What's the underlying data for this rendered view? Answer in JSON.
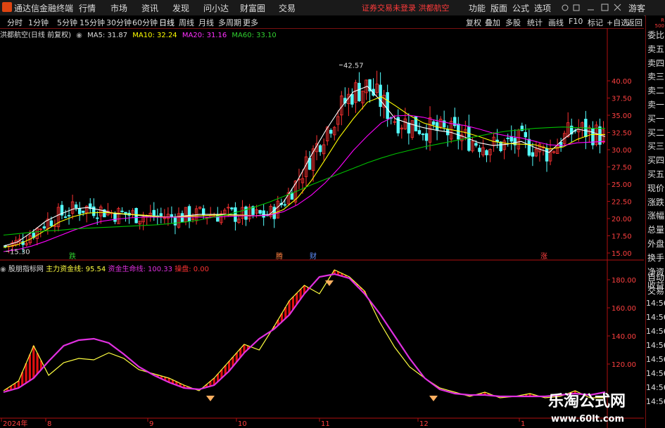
{
  "topbar": {
    "app_title": "通达信金融终端",
    "menus": [
      "行情",
      "市场",
      "资讯",
      "发现",
      "问小达",
      "财富圈",
      "交易"
    ],
    "notice": "证券交易未登录  洪都航空",
    "right_menus": [
      "功能",
      "版面",
      "公式",
      "选项"
    ],
    "guest": "游客"
  },
  "periodbar": {
    "periods": [
      "分时",
      "1分钟",
      "5分钟",
      "15分钟",
      "30分钟",
      "60分钟",
      "日线",
      "周线",
      "月线",
      "多周期",
      "更多"
    ],
    "active": "日线",
    "tools": [
      "复权",
      "叠加",
      "多股",
      "统计",
      "画线",
      "F10",
      "标记",
      "+自选",
      "返回"
    ]
  },
  "infoline": {
    "stock": "洪都航空(日线 前复权)",
    "ma5": "MA5: 31.87",
    "ma10": "MA10: 32.24",
    "ma20": "MA20: 31.16",
    "ma60": "MA60: 33.10"
  },
  "indicator": {
    "name": "股朋指标网",
    "main_fund": "主力资金线: 95.54",
    "life_line": "资金生命线: 100.33",
    "operate": "操盘: 0.00"
  },
  "rightpanel": {
    "r_label": "R\n500",
    "items": [
      "委比",
      "卖五",
      "卖四",
      "卖三",
      "卖二",
      "卖一",
      "买一",
      "买二",
      "买三",
      "买四",
      "买五",
      "现价",
      "涨跌",
      "涨幅",
      "总量",
      "外盘",
      "换手",
      "净资",
      "收益"
    ],
    "lower": [
      "自动",
      "交易"
    ],
    "times": [
      "14:56",
      "14:56",
      "14:56",
      "14:56",
      "14:56",
      "14:56",
      "14:56",
      "14:56"
    ]
  },
  "colors": {
    "up": "#ff3232",
    "down": "#54ffff",
    "ma5": "#ffffff",
    "ma10": "#ffff00",
    "ma20": "#ff00ff",
    "ma60": "#00c000",
    "life": "#e030e0",
    "fund": "#ffff40",
    "axis": "#b01010"
  },
  "chart_data": [
    {
      "type": "candlestick",
      "title": "洪都航空(日线 前复权)",
      "y_ticks": [
        "40.00",
        "37.50",
        "35.00",
        "32.50",
        "30.00",
        "27.50",
        "25.00",
        "22.50",
        "20.00",
        "17.50",
        "15.00"
      ],
      "ylim": [
        14.5,
        43.5
      ],
      "annotations": {
        "high": "42.57",
        "low": "15.30"
      },
      "markers": [
        "跌",
        "腾",
        "财",
        "涨"
      ],
      "x_ticks": [
        "2024年",
        "8",
        "9",
        "10",
        "11",
        "12",
        "1"
      ],
      "series": [
        {
          "name": "MA5",
          "values": [
            16.0,
            16.6,
            18.0,
            19.6,
            20.6,
            21.4,
            21.6,
            21.2,
            20.7,
            20.6,
            20.4,
            20.3,
            20.2,
            20.4,
            20.6,
            20.6,
            20.6,
            20.5,
            20.4,
            20.6,
            22.4,
            25.5,
            29.2,
            32.7,
            35.8,
            38.4,
            39.2,
            37.0,
            34.5,
            33.8,
            33.2,
            32.8,
            32.5,
            31.8,
            31.0,
            30.6,
            30.8,
            31.2,
            30.3,
            29.6,
            31.5,
            33.0,
            32.6,
            31.9
          ]
        },
        {
          "name": "MA10",
          "values": [
            15.8,
            16.2,
            17.1,
            18.3,
            19.5,
            20.3,
            20.8,
            20.9,
            20.8,
            20.6,
            20.5,
            20.3,
            20.2,
            20.3,
            20.4,
            20.5,
            20.5,
            20.5,
            20.4,
            20.5,
            21.3,
            23.0,
            25.5,
            28.6,
            31.8,
            34.5,
            36.9,
            37.7,
            36.4,
            35.0,
            33.9,
            33.3,
            32.9,
            32.5,
            31.9,
            31.2,
            30.9,
            30.8,
            30.7,
            30.1,
            30.4,
            31.5,
            32.2,
            32.2
          ]
        },
        {
          "name": "MA20",
          "values": [
            15.2,
            15.5,
            16.0,
            16.7,
            17.5,
            18.3,
            19.0,
            19.6,
            19.9,
            20.1,
            20.2,
            20.2,
            20.2,
            20.2,
            20.2,
            20.2,
            20.3,
            20.4,
            20.4,
            20.5,
            21.0,
            22.0,
            23.4,
            25.2,
            27.4,
            29.9,
            32.0,
            33.9,
            34.9,
            35.0,
            34.7,
            34.2,
            33.8,
            33.5,
            33.0,
            32.4,
            32.0,
            31.7,
            31.2,
            30.7,
            30.6,
            31.0,
            31.1,
            31.2
          ]
        },
        {
          "name": "MA60",
          "values": [
            17.6,
            17.8,
            18.0,
            18.2,
            18.3,
            18.5,
            18.6,
            18.7,
            18.8,
            18.9,
            19.0,
            19.1,
            19.3,
            19.5,
            19.8,
            20.2,
            20.6,
            21.1,
            21.7,
            22.4,
            23.2,
            24.0,
            24.9,
            25.7,
            26.5,
            27.3,
            28.1,
            28.8,
            29.4,
            29.9,
            30.4,
            30.8,
            31.2,
            31.6,
            32.0,
            32.4,
            32.7,
            32.9,
            33.1,
            33.2,
            33.3,
            33.2,
            33.1,
            33.1
          ]
        }
      ]
    },
    {
      "type": "line",
      "title": "股朋指标网",
      "y_ticks": [
        "180.00",
        "160.00",
        "140.00",
        "120.00"
      ],
      "ylim": [
        95,
        195
      ],
      "series": [
        {
          "name": "资金生命线",
          "values": [
            100,
            103,
            110,
            122,
            133,
            137,
            138,
            135,
            127,
            118,
            112,
            107,
            103,
            102,
            105,
            115,
            128,
            138,
            145,
            155,
            170,
            182,
            184,
            181,
            170,
            156,
            140,
            124,
            110,
            102,
            99,
            98,
            98,
            97,
            97,
            97,
            97,
            98,
            99,
            98,
            100
          ]
        },
        {
          "name": "主力资金线",
          "values": [
            101,
            108,
            133,
            112,
            121,
            124,
            123,
            128,
            124,
            116,
            113,
            110,
            105,
            101,
            110,
            122,
            134,
            130,
            147,
            165,
            176,
            170,
            187,
            182,
            172,
            150,
            132,
            118,
            110,
            103,
            100,
            97,
            100,
            96,
            97,
            99,
            96,
            97,
            101,
            96,
            96
          ]
        }
      ]
    }
  ],
  "watermark": {
    "big": "乐淘公式网",
    "url": "www.60lt.com"
  }
}
